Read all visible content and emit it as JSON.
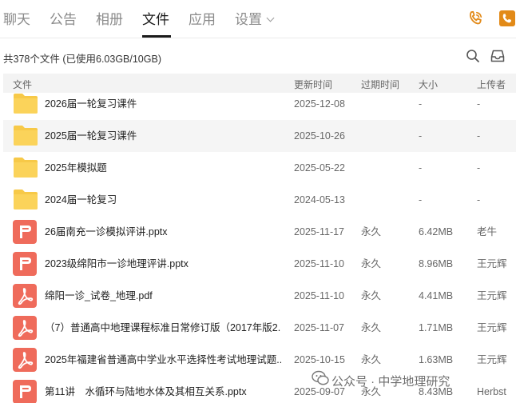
{
  "nav": {
    "tabs": [
      {
        "label": "聊天"
      },
      {
        "label": "公告"
      },
      {
        "label": "相册"
      },
      {
        "label": "文件"
      },
      {
        "label": "应用"
      },
      {
        "label": "设置"
      }
    ],
    "active_tab": "文件",
    "right_icons": [
      "phone-ring-icon",
      "phone-square-icon"
    ],
    "accent_color": "#e28a18"
  },
  "summary": {
    "text": "共378个文件 (已使用6.03GB/10GB)",
    "icons": [
      "search-icon",
      "inbox-icon"
    ]
  },
  "table": {
    "headers": {
      "name": "文件",
      "updated": "更新时间",
      "expiry": "过期时间",
      "size": "大小",
      "uploader": "上传者"
    },
    "rows": [
      {
        "icon": "folder-icon",
        "name": "2026届一轮复习课件",
        "updated": "2025-12-08",
        "expiry": "",
        "size": "-",
        "uploader": "-"
      },
      {
        "icon": "folder-icon",
        "name": "2025届一轮复习课件",
        "updated": "2025-10-26",
        "expiry": "",
        "size": "-",
        "uploader": "-"
      },
      {
        "icon": "folder-icon",
        "name": "2025年模拟题",
        "updated": "2025-05-22",
        "expiry": "",
        "size": "-",
        "uploader": "-"
      },
      {
        "icon": "folder-icon",
        "name": "2024届一轮复习",
        "updated": "2024-05-13",
        "expiry": "",
        "size": "-",
        "uploader": "-"
      },
      {
        "icon": "pptx-icon",
        "name": "26届南充一诊模拟评讲.pptx",
        "updated": "2025-11-17",
        "expiry": "永久",
        "size": "6.42MB",
        "uploader": "老牛"
      },
      {
        "icon": "pptx-icon",
        "name": "2023级绵阳市一诊地理评讲.pptx",
        "updated": "2025-11-10",
        "expiry": "永久",
        "size": "8.96MB",
        "uploader": "王元辉"
      },
      {
        "icon": "pdf-icon",
        "name": "绵阳一诊_试卷_地理.pdf",
        "updated": "2025-11-10",
        "expiry": "永久",
        "size": "4.41MB",
        "uploader": "王元辉"
      },
      {
        "icon": "pdf-icon",
        "name": "（7）普通高中地理课程标准日常修订版（2017年版2...",
        "updated": "2025-11-07",
        "expiry": "永久",
        "size": "1.71MB",
        "uploader": "王元辉"
      },
      {
        "icon": "pdf-icon",
        "name": "2025年福建省普通高中学业水平选择性考试地理试题...",
        "updated": "2025-10-15",
        "expiry": "永久",
        "size": "1.63MB",
        "uploader": "王元辉"
      },
      {
        "icon": "pptx-icon",
        "name": "第11讲　水循环与陆地水体及其相互关系.pptx",
        "updated": "2025-09-07",
        "expiry": "永久",
        "size": "8.43MB",
        "uploader": "Herbst"
      }
    ]
  },
  "watermark": {
    "text": "公众号 · 中学地理研究"
  }
}
